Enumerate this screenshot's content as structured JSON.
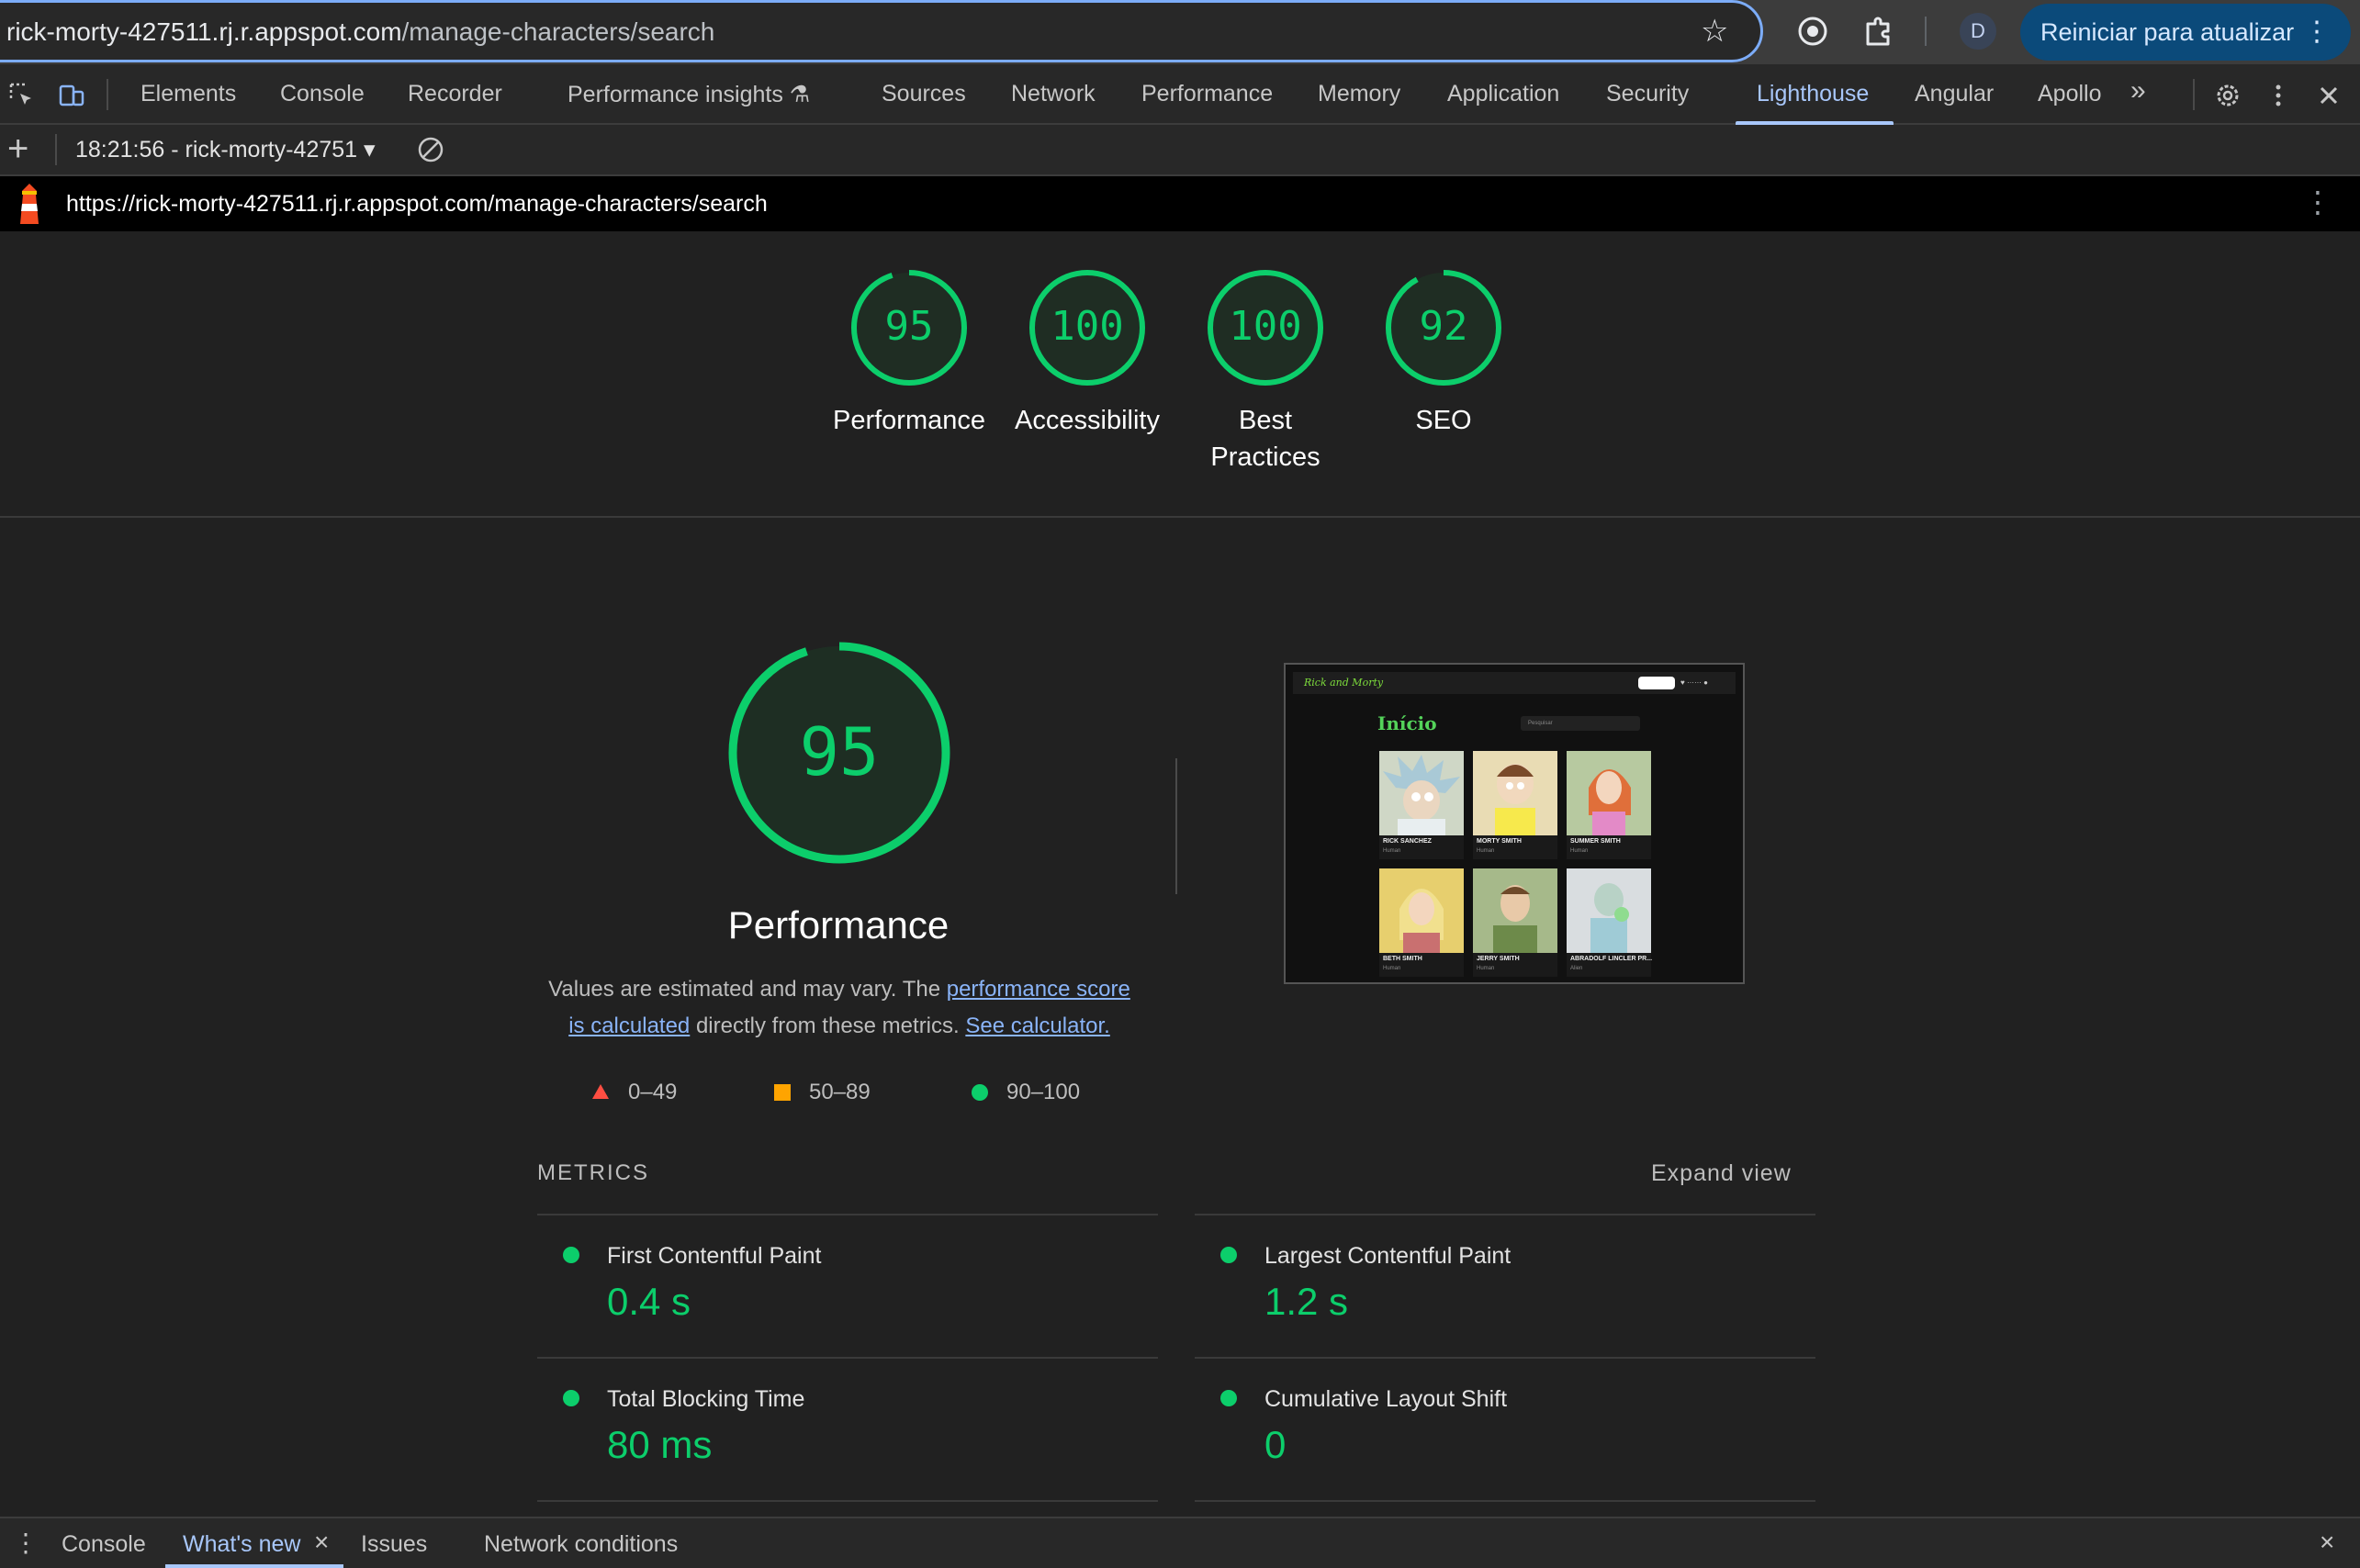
{
  "browser": {
    "url_host": "rick-morty-427511.rj.r.appspot.com",
    "url_path": "/manage-characters/search",
    "profile_initial": "D",
    "update_button": "Reiniciar para atualizar"
  },
  "devtools": {
    "tabs": [
      "Elements",
      "Console",
      "Recorder",
      "Performance insights",
      "Sources",
      "Network",
      "Performance",
      "Memory",
      "Application",
      "Security",
      "Lighthouse",
      "Angular",
      "Apollo"
    ],
    "active_tab": "Lighthouse",
    "overflow": "»"
  },
  "lighthouse": {
    "report_select": "18:21:56 - rick-morty-42751",
    "tested_url": "https://rick-morty-427511.rj.r.appspot.com/manage-characters/search",
    "gauges": [
      {
        "score": "95",
        "label": "Performance"
      },
      {
        "score": "100",
        "label": "Accessibility"
      },
      {
        "score": "100",
        "label": "Best Practices"
      },
      {
        "score": "92",
        "label": "SEO"
      }
    ],
    "accent_color": "#0cce6b",
    "perf": {
      "score": "95",
      "title": "Performance",
      "desc_1": "Values are estimated and may vary. The ",
      "desc_link_1": "performance score is calculated",
      "desc_2": " directly from these metrics. ",
      "desc_link_2": "See calculator.",
      "legend": [
        "0–49",
        "50–89",
        "90–100"
      ]
    },
    "screenshot": {
      "brand": "Rick and Morty",
      "heading": "Início",
      "search_placeholder": "Pesquisar",
      "cards": [
        {
          "name": "RICK SANCHEZ",
          "species": "Human"
        },
        {
          "name": "MORTY SMITH",
          "species": "Human"
        },
        {
          "name": "SUMMER SMITH",
          "species": "Human"
        },
        {
          "name": "BETH SMITH",
          "species": "Human"
        },
        {
          "name": "JERRY SMITH",
          "species": "Human"
        },
        {
          "name": "ABRADOLF LINCLER PR...",
          "species": "Alien"
        }
      ]
    },
    "metrics_heading": "METRICS",
    "expand_view": "Expand view",
    "metrics": [
      {
        "title": "First Contentful Paint",
        "value": "0.4 s"
      },
      {
        "title": "Largest Contentful Paint",
        "value": "1.2 s"
      },
      {
        "title": "Total Blocking Time",
        "value": "80 ms"
      },
      {
        "title": "Cumulative Layout Shift",
        "value": "0"
      }
    ]
  },
  "drawer": {
    "tabs": [
      "Console",
      "What's new",
      "Issues",
      "Network conditions"
    ],
    "active_tab": "What's new"
  }
}
